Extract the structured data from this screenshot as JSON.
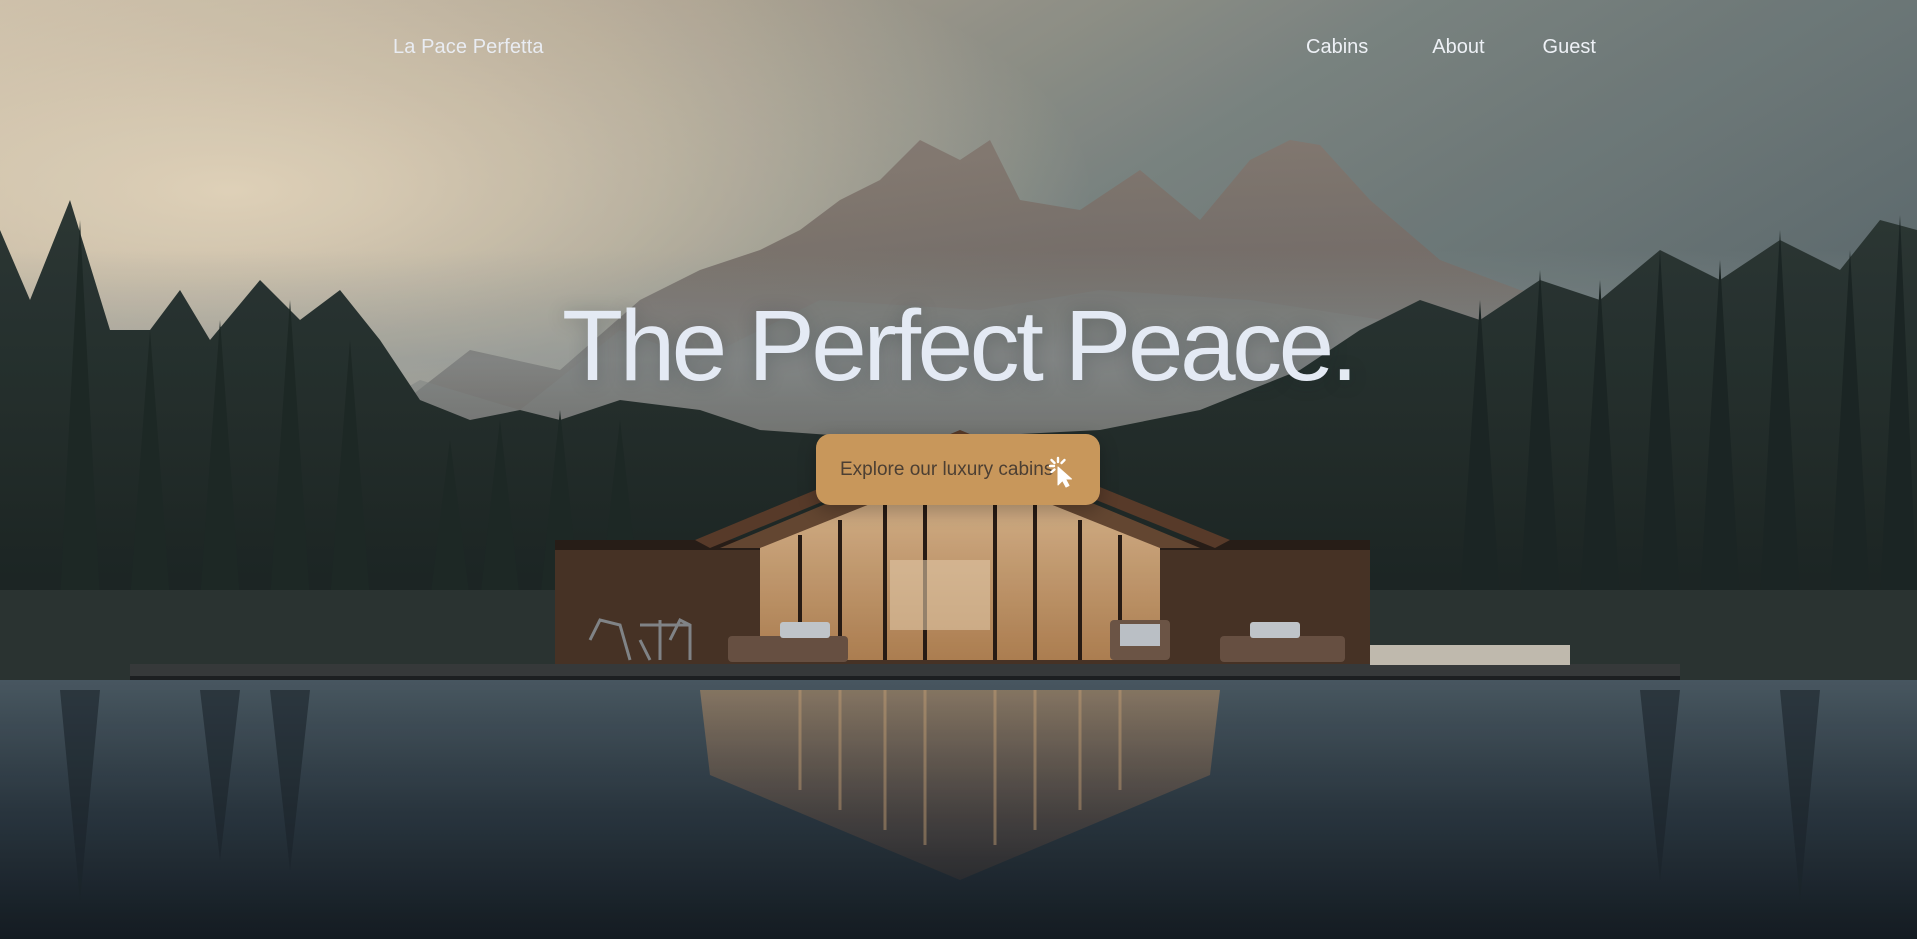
{
  "nav": {
    "brand": "La Pace Perfetta",
    "links": [
      "Cabins",
      "About",
      "Guest"
    ]
  },
  "hero": {
    "title": "The Perfect Peace.",
    "cta_label": "Explore our luxury cabins",
    "cta_icon": "cursor-click-icon"
  },
  "colors": {
    "accent": "#c8975b",
    "text_light": "#e4eaf4",
    "cta_text": "#4c3f33"
  }
}
